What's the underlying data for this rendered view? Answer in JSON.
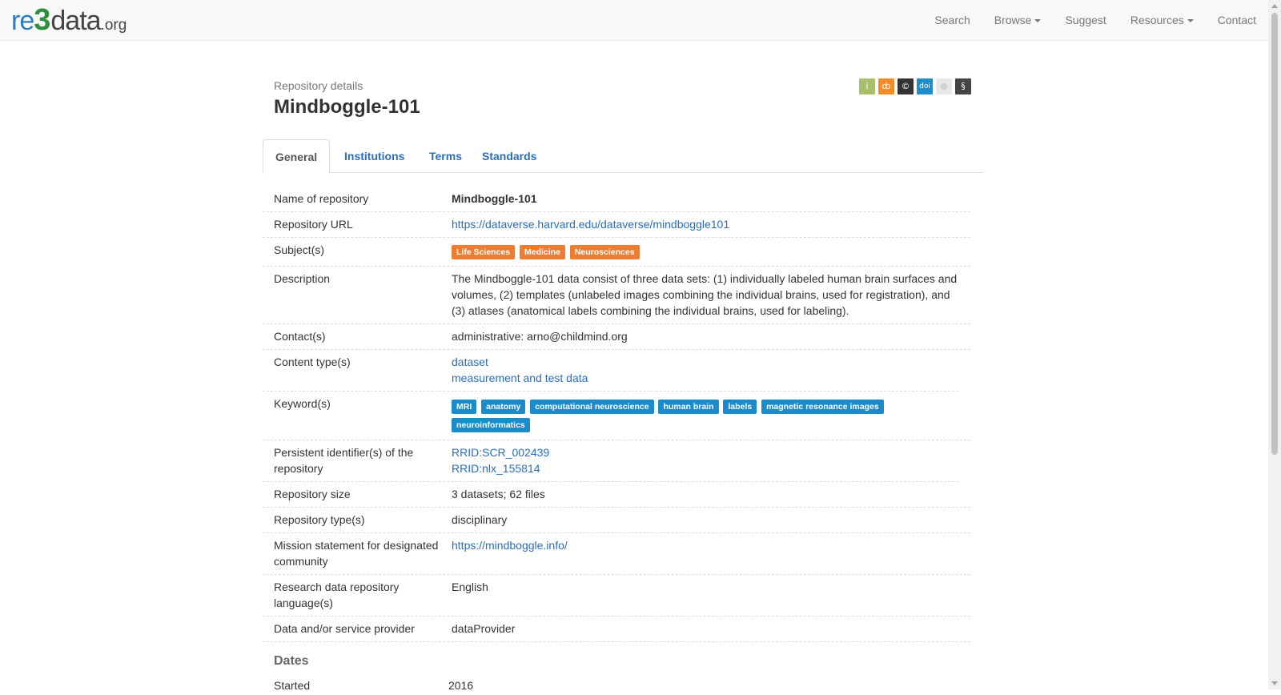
{
  "navbar": {
    "brand": {
      "re": "re",
      "three": "3",
      "data": "data",
      "org": ".org"
    },
    "links": [
      {
        "label": "Search",
        "dropdown": false
      },
      {
        "label": "Browse",
        "dropdown": true
      },
      {
        "label": "Suggest",
        "dropdown": false
      },
      {
        "label": "Resources",
        "dropdown": true
      },
      {
        "label": "Contact",
        "dropdown": false
      }
    ]
  },
  "header": {
    "subtitle": "Repository details",
    "title": "Mindboggle-101",
    "badges": [
      {
        "name": "info-icon",
        "glyph": "i",
        "color": "#a8c06b"
      },
      {
        "name": "open-access-icon",
        "glyph": "ȸ",
        "color": "#f28c28"
      },
      {
        "name": "copyright-icon",
        "glyph": "©",
        "color": "#333333"
      },
      {
        "name": "doi-icon",
        "glyph": "doi",
        "color": "#1f8ccc"
      },
      {
        "name": "certificate-icon",
        "glyph": "●",
        "color": "#e8e8e8"
      },
      {
        "name": "policy-icon",
        "glyph": "§",
        "color": "#444444"
      }
    ]
  },
  "tabs": [
    "General",
    "Institutions",
    "Terms",
    "Standards"
  ],
  "details": {
    "name_label": "Name of repository",
    "name_value": "Mindboggle-101",
    "url_label": "Repository URL",
    "url_value": "https://dataverse.harvard.edu/dataverse/mindboggle101",
    "subjects_label": "Subject(s)",
    "subjects": [
      "Life Sciences",
      "Medicine",
      "Neurosciences"
    ],
    "description_label": "Description",
    "description_value": "The Mindboggle-101 data consist of three data sets: (1) individually labeled human brain surfaces and volumes, (2) templates (unlabeled images combining the individual brains, used for registration), and (3) atlases (anatomical labels combining the individual brains, used for labeling).",
    "contacts_label": "Contact(s)",
    "contacts_value": "administrative: arno@childmind.org",
    "content_label": "Content type(s)",
    "content_types": [
      "dataset",
      "measurement and test data"
    ],
    "keywords_label": "Keyword(s)",
    "keywords": [
      "MRI",
      "anatomy",
      "computational neuroscience",
      "human brain",
      "labels",
      "magnetic resonance images",
      "neuroinformatics"
    ],
    "pid_label": "Persistent identifier(s) of the repository",
    "pids": [
      "RRID:SCR_002439",
      "RRID:nlx_155814"
    ],
    "size_label": "Repository size",
    "size_value": "3 datasets; 62 files",
    "type_label": "Repository type(s)",
    "type_value": "disciplinary",
    "mission_label": "Mission statement for designated community",
    "mission_value": "https://mindboggle.info/",
    "language_label": "Research data repository language(s)",
    "language_value": "English",
    "provider_label": "Data and/or service provider",
    "provider_value": "dataProvider"
  },
  "dates": {
    "title": "Dates",
    "started_label": "Started",
    "started_value": "2016"
  }
}
